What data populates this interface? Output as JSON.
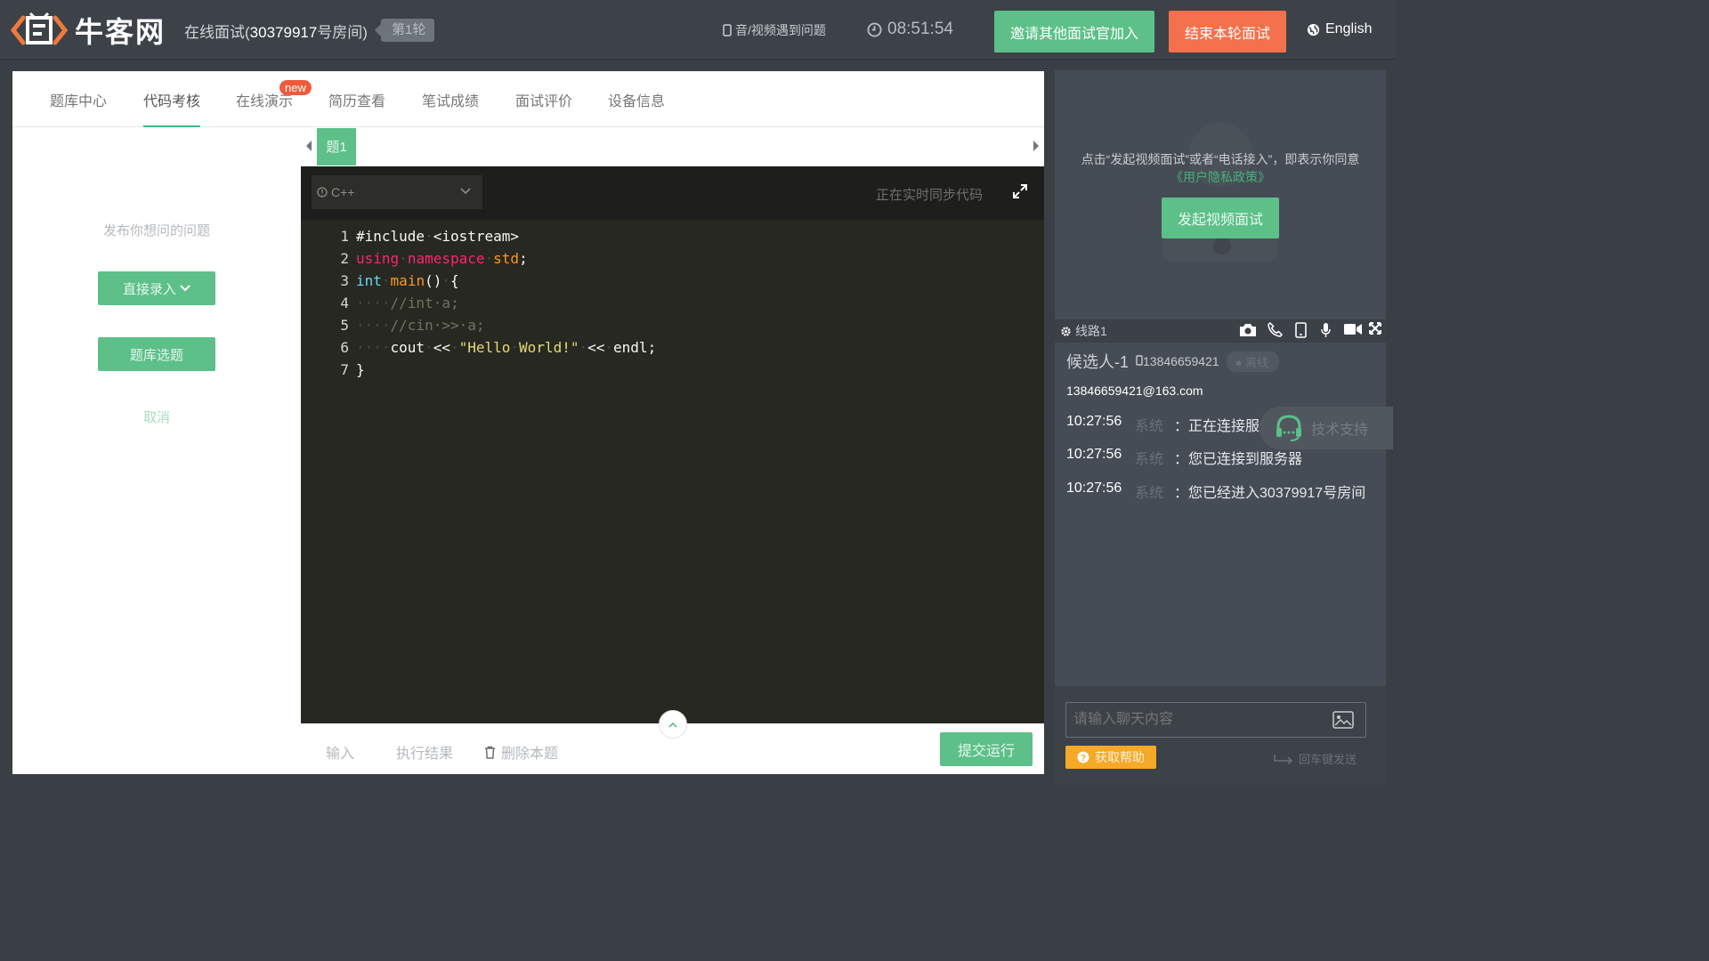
{
  "header": {
    "logo_text": "牛客网",
    "room_prefix": "在线面试(",
    "room_number": "30379917",
    "room_suffix": "号房间)",
    "round_label": "第1轮",
    "av_issue": "音/视频遇到问题",
    "timer": "08:51:54",
    "invite_button": "邀请其他面试官加入",
    "end_button": "结束本轮面试",
    "language": "English"
  },
  "tabs": [
    "题库中心",
    "代码考核",
    "在线演示",
    "简历查看",
    "笔试成绩",
    "面试评价",
    "设备信息"
  ],
  "active_tab": "代码考核",
  "new_badge": "new",
  "left": {
    "ask_label": "发布你想问的问题",
    "direct_entry": "直接录入",
    "bank_select": "题库选题",
    "cancel": "取消"
  },
  "question_tab": "题1",
  "editor": {
    "language": "C++",
    "sync_status": "正在实时同步代码",
    "line_numbers": [
      "1",
      "2",
      "3",
      "4",
      "5",
      "6",
      "7"
    ]
  },
  "footer": {
    "input_tab": "输入",
    "result_tab": "执行结果",
    "delete_tab": "删除本题",
    "run_button": "提交运行"
  },
  "right": {
    "notice_pre": "点击“发起视频面试”或者“电话接入”，即表示你同意",
    "privacy_link": "《用户隐私政策》",
    "start_video": "发起视频面试",
    "line_label": "线路1",
    "candidate": "候选人-1",
    "candidate_phone": "13846659421",
    "status": "离线",
    "email": "13846659421@163.com",
    "support": "技术支持",
    "messages": [
      {
        "time": "10:27:56",
        "sender": "系统",
        "sep": "：",
        "text": "正在连接服务器"
      },
      {
        "time": "10:27:56",
        "sender": "系统",
        "sep": "：",
        "text": "您已连接到服务器"
      },
      {
        "time": "10:27:56",
        "sender": "系统",
        "sep": "：",
        "text": "您已经进入30379917号房间"
      }
    ],
    "chat_placeholder": "请输入聊天内容",
    "help_button": "获取帮助",
    "enter_send": "回车键发送"
  },
  "colors": {
    "brand_green": "#5cc088",
    "danger_orange": "#f4714b",
    "help_yellow": "#f6a827"
  }
}
